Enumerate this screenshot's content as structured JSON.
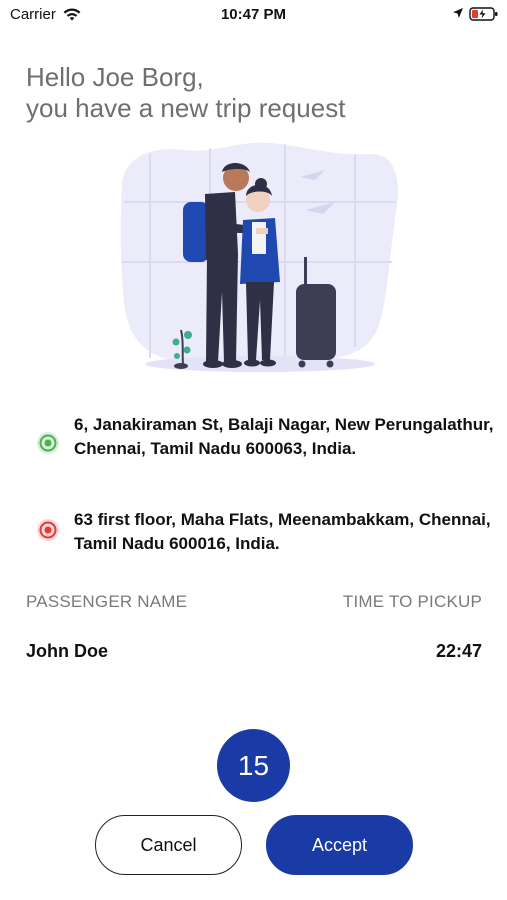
{
  "status_bar": {
    "carrier": "Carrier",
    "time": "10:47 PM",
    "wifi_icon": "wifi-icon",
    "location_icon": "location-arrow-icon",
    "battery_icon": "battery-charging-icon"
  },
  "greeting": {
    "line1": "Hello Joe Borg,",
    "line2": "you have a new trip request"
  },
  "illustration": {
    "description_icon": "travelers-illustration"
  },
  "pickup": {
    "address": "6, Janakiraman St, Balaji Nagar, New Perungalathur, Chennai, Tamil Nadu 600063, India.",
    "color": "#4caf50"
  },
  "dropoff": {
    "address": "63 first floor, Maha Flats, Meenambakkam, Chennai, Tamil Nadu 600016, India.",
    "color": "#e53935"
  },
  "details": {
    "passenger_label": "PASSENGER NAME",
    "pickup_time_label": "TIME TO PICKUP",
    "passenger_name": "John Doe",
    "pickup_time": "22:47"
  },
  "countdown": {
    "value": "15"
  },
  "actions": {
    "cancel_label": "Cancel",
    "accept_label": "Accept"
  },
  "colors": {
    "primary": "#1a3aa6",
    "greeting_text": "#6f6f6f",
    "label_text": "#7a7a7a"
  }
}
